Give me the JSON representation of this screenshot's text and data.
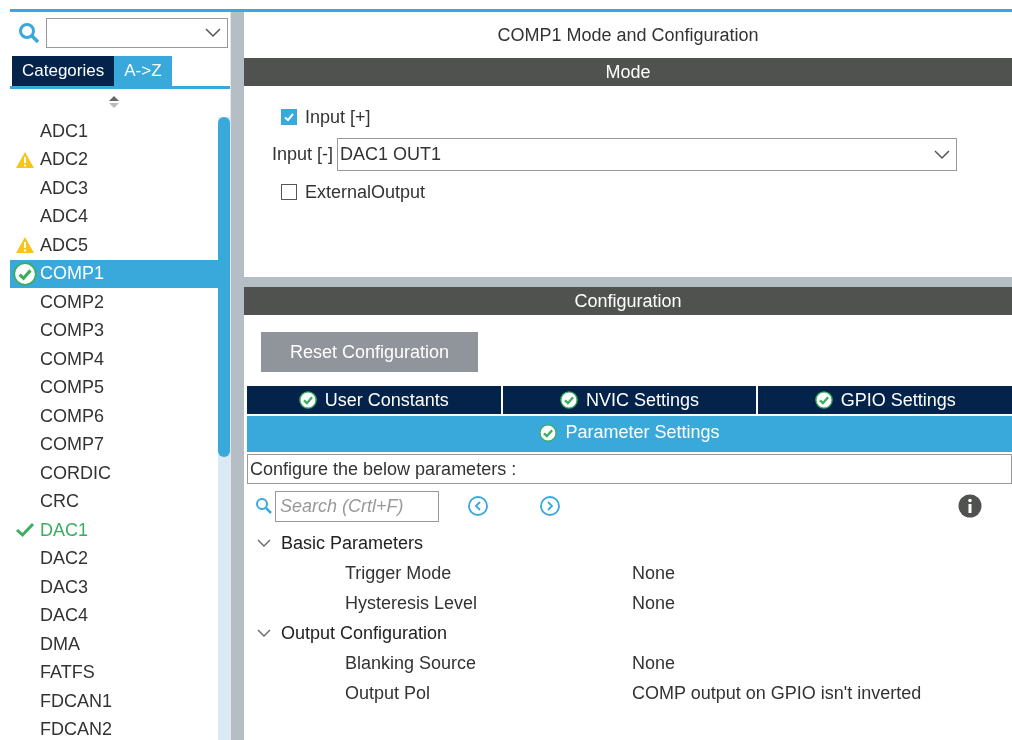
{
  "sidebar": {
    "tabs": [
      {
        "label": "Categories",
        "selected": false
      },
      {
        "label": "A->Z",
        "selected": true
      }
    ],
    "items": [
      {
        "label": "ADC1",
        "kind": "plain",
        "selected": false
      },
      {
        "label": "ADC2",
        "kind": "warning",
        "selected": false
      },
      {
        "label": "ADC3",
        "kind": "plain",
        "selected": false
      },
      {
        "label": "ADC4",
        "kind": "plain",
        "selected": false
      },
      {
        "label": "ADC5",
        "kind": "warning",
        "selected": false
      },
      {
        "label": "COMP1",
        "kind": "ok",
        "selected": true
      },
      {
        "label": "COMP2",
        "kind": "plain",
        "selected": false
      },
      {
        "label": "COMP3",
        "kind": "plain",
        "selected": false
      },
      {
        "label": "COMP4",
        "kind": "plain",
        "selected": false
      },
      {
        "label": "COMP5",
        "kind": "plain",
        "selected": false
      },
      {
        "label": "COMP6",
        "kind": "plain",
        "selected": false
      },
      {
        "label": "COMP7",
        "kind": "plain",
        "selected": false
      },
      {
        "label": "CORDIC",
        "kind": "plain",
        "selected": false
      },
      {
        "label": "CRC",
        "kind": "plain",
        "selected": false
      },
      {
        "label": "DAC1",
        "kind": "enabled",
        "selected": false
      },
      {
        "label": "DAC2",
        "kind": "plain",
        "selected": false
      },
      {
        "label": "DAC3",
        "kind": "plain",
        "selected": false
      },
      {
        "label": "DAC4",
        "kind": "plain",
        "selected": false
      },
      {
        "label": "DMA",
        "kind": "plain",
        "selected": false
      },
      {
        "label": "FATFS",
        "kind": "plain",
        "selected": false
      },
      {
        "label": "FDCAN1",
        "kind": "plain",
        "selected": false
      },
      {
        "label": "FDCAN2",
        "kind": "plain",
        "selected": false
      }
    ]
  },
  "main": {
    "title": "COMP1 Mode and Configuration",
    "mode": {
      "header": "Mode",
      "input_plus": {
        "label": "Input [+]",
        "checked": true
      },
      "input_minus": {
        "label": "Input [-]",
        "value": "DAC1 OUT1"
      },
      "external_output": {
        "label": "ExternalOutput",
        "checked": false
      }
    },
    "configuration": {
      "header": "Configuration",
      "reset_button": "Reset Configuration",
      "tabs": [
        {
          "label": "User Constants",
          "selected": false
        },
        {
          "label": "NVIC Settings",
          "selected": false
        },
        {
          "label": "GPIO Settings",
          "selected": false
        },
        {
          "label": "Parameter Settings",
          "selected": true
        }
      ],
      "description": "Configure the below parameters :",
      "search": {
        "placeholder": "Search (Crtl+F)"
      },
      "groups": [
        {
          "label": "Basic Parameters",
          "expanded": true,
          "children": [
            {
              "name": "Trigger Mode",
              "value": "None"
            },
            {
              "name": "Hysteresis Level",
              "value": "None"
            }
          ]
        },
        {
          "label": "Output Configuration",
          "expanded": true,
          "children": [
            {
              "name": "Blanking Source",
              "value": "None"
            },
            {
              "name": "Output Pol",
              "value": "COMP output on GPIO isn't inverted"
            }
          ]
        }
      ]
    }
  }
}
